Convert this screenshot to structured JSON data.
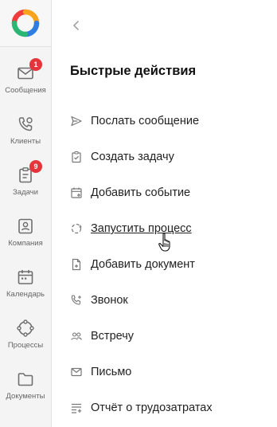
{
  "sidebar": {
    "items": [
      {
        "label": "Сообщения",
        "icon": "envelope-icon",
        "badge": "1"
      },
      {
        "label": "Клиенты",
        "icon": "phone-icon"
      },
      {
        "label": "Задачи",
        "icon": "clipboard-icon",
        "badge": "9"
      },
      {
        "label": "Компания",
        "icon": "company-icon"
      },
      {
        "label": "Календарь",
        "icon": "calendar-icon"
      },
      {
        "label": "Процессы",
        "icon": "process-cycle-icon"
      },
      {
        "label": "Документы",
        "icon": "folder-icon"
      }
    ]
  },
  "panel": {
    "title": "Быстрые действия",
    "actions": [
      {
        "label": "Послать сообщение",
        "icon": "send-icon"
      },
      {
        "label": "Создать задачу",
        "icon": "task-icon"
      },
      {
        "label": "Добавить событие",
        "icon": "event-icon"
      },
      {
        "label": "Запустить процесс",
        "icon": "process-icon"
      },
      {
        "label": "Добавить документ",
        "icon": "document-icon"
      },
      {
        "label": "Звонок",
        "icon": "call-icon"
      },
      {
        "label": "Встречу",
        "icon": "meeting-icon"
      },
      {
        "label": "Письмо",
        "icon": "mail-icon"
      },
      {
        "label": "Отчёт о трудозатратах",
        "icon": "report-icon"
      }
    ]
  },
  "colors": {
    "badge": "#e5343a",
    "sidebar_bg": "#f4f4f4",
    "icon_gray": "#6e6e6e",
    "logo_red": "#ef3b3b",
    "logo_orange": "#f7a31c",
    "logo_blue": "#2f7de1",
    "logo_green": "#2bb673"
  }
}
